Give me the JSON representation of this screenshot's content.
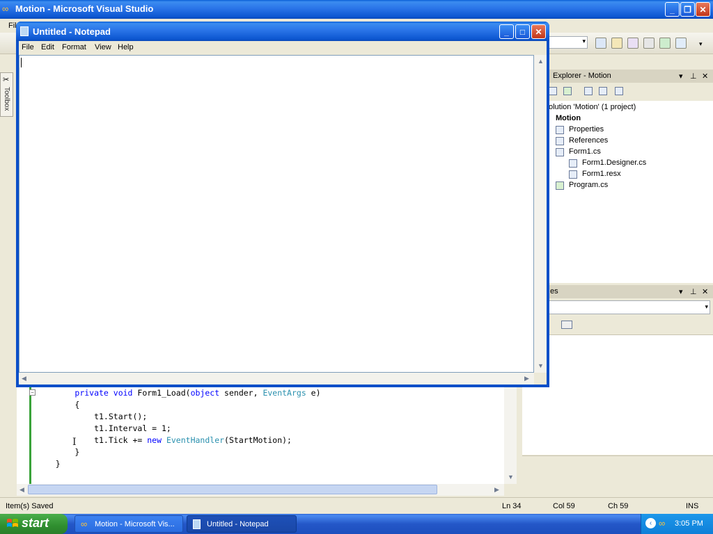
{
  "vs": {
    "title": "Motion - Microsoft Visual Studio",
    "menu_partial": "Fil",
    "toolbox_label": "Toolbox",
    "solution_explorer": {
      "title": "Explorer - Motion",
      "items": [
        {
          "label": "olution 'Motion' (1 project)"
        },
        {
          "label": "Motion"
        },
        {
          "label": "Properties"
        },
        {
          "label": "References"
        },
        {
          "label": "Form1.cs"
        },
        {
          "label": "Form1.Designer.cs"
        },
        {
          "label": "Form1.resx"
        },
        {
          "label": "Program.cs"
        }
      ]
    },
    "properties": {
      "title": "es"
    },
    "code": {
      "lines": [
        {
          "prefix": "        ",
          "kw": "private void ",
          "rest_a": "Form1_Load(",
          "kw2": "object ",
          "rest_b": "sender, ",
          "type": "EventArgs",
          "rest_c": " e)"
        },
        {
          "text": "        {"
        },
        {
          "text": "            t1.Start();"
        },
        {
          "text": "            t1.Interval = 1;"
        },
        {
          "prefix": "            t1.Tick += ",
          "kw": "new ",
          "type": "EventHandler",
          "rest": "(StartMotion);"
        },
        {
          "text": "        }"
        },
        {
          "text": "    }"
        }
      ]
    },
    "status": {
      "message": "Item(s) Saved",
      "ln": "Ln 34",
      "col": "Col 59",
      "ch": "Ch 59",
      "mode": "INS"
    }
  },
  "notepad": {
    "title": "Untitled - Notepad",
    "menu": [
      "File",
      "Edit",
      "Format",
      "View",
      "Help"
    ],
    "content": ""
  },
  "taskbar": {
    "start": "start",
    "tasks": [
      {
        "label": "Motion - Microsoft Vis..."
      },
      {
        "label": "Untitled - Notepad"
      }
    ],
    "clock": "3:05 PM"
  },
  "colors": {
    "xp_blue": "#0a5fd6",
    "keyword": "#0000ff",
    "type": "#2b91af",
    "start_green": "#3a9a3a"
  }
}
